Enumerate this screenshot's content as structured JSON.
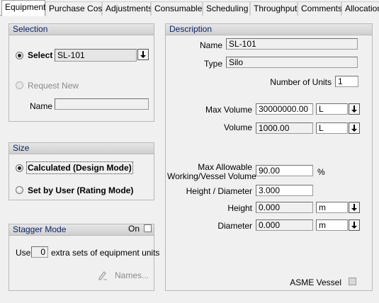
{
  "tabs": [
    {
      "label": "Equipment"
    },
    {
      "label": "Purchase Cost"
    },
    {
      "label": "Adjustments"
    },
    {
      "label": "Consumables"
    },
    {
      "label": "Scheduling"
    },
    {
      "label": "Throughput"
    },
    {
      "label": "Comments"
    },
    {
      "label": "Allocation"
    }
  ],
  "selection": {
    "title": "Selection",
    "select_label": "Select",
    "select_value": "SL-101",
    "request_new_label": "Request New",
    "name_label": "Name",
    "name_value": ""
  },
  "size": {
    "title": "Size",
    "calculated_label": "Calculated (Design Mode)",
    "set_by_user_label": "Set by User (Rating Mode)"
  },
  "stagger": {
    "title": "Stagger Mode",
    "on_label": "On",
    "use_label": "Use",
    "use_value": "0",
    "extra_label": "extra sets of equipment units",
    "names_label": "Names..."
  },
  "description": {
    "title": "Description",
    "name_label": "Name",
    "name_value": "SL-101",
    "type_label": "Type",
    "type_value": "Silo",
    "units_label": "Number of Units",
    "units_value": "1",
    "max_volume_label": "Max Volume",
    "max_volume_value": "30000000.00",
    "max_volume_unit": "L",
    "volume_label": "Volume",
    "volume_value": "1000.00",
    "volume_unit": "L",
    "max_allow_label_1": "Max Allowable",
    "max_allow_label_2": "Working/Vessel Volume",
    "max_allow_value": "90.00",
    "max_allow_unit": "%",
    "hd_label": "Height / Diameter",
    "hd_value": "3.000",
    "height_label": "Height",
    "height_value": "0.000",
    "height_unit": "m",
    "diameter_label": "Diameter",
    "diameter_value": "0.000",
    "diameter_unit": "m",
    "asme_label": "ASME Vessel"
  }
}
